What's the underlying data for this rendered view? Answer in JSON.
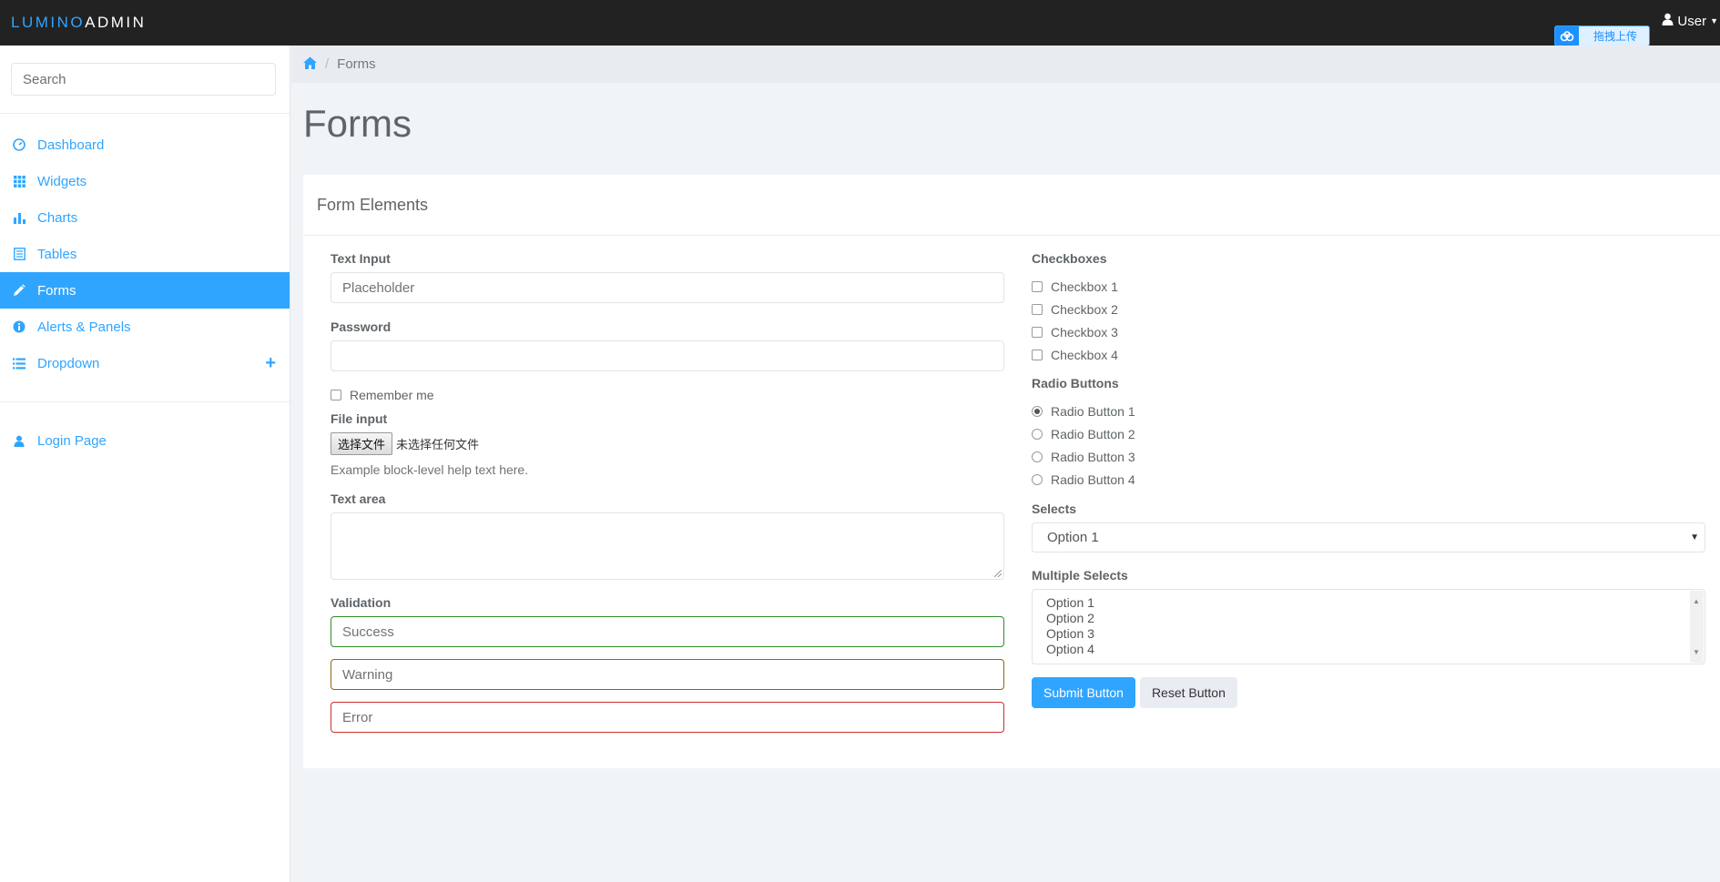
{
  "brand": {
    "part1": "LUMINO",
    "part2": "ADMIN"
  },
  "upload_badge": {
    "label": "拖拽上传"
  },
  "user_menu": {
    "label": "User"
  },
  "sidebar": {
    "search_placeholder": "Search",
    "items": [
      {
        "label": "Dashboard",
        "icon": "dashboard-icon"
      },
      {
        "label": "Widgets",
        "icon": "grid-icon"
      },
      {
        "label": "Charts",
        "icon": "bar-chart-icon"
      },
      {
        "label": "Tables",
        "icon": "table-icon"
      },
      {
        "label": "Forms",
        "icon": "pencil-icon",
        "active": true
      },
      {
        "label": "Alerts & Panels",
        "icon": "info-icon"
      },
      {
        "label": "Dropdown",
        "icon": "list-icon",
        "expand": "+"
      }
    ],
    "login_item": {
      "label": "Login Page",
      "icon": "user-icon"
    }
  },
  "breadcrumb": {
    "current": "Forms"
  },
  "page": {
    "title": "Forms"
  },
  "panel": {
    "heading": "Form Elements",
    "text_input": {
      "label": "Text Input",
      "placeholder": "Placeholder"
    },
    "password": {
      "label": "Password"
    },
    "remember": {
      "label": "Remember me"
    },
    "file_input": {
      "label": "File input",
      "button": "选择文件",
      "status": "未选择任何文件",
      "help": "Example block-level help text here."
    },
    "textarea": {
      "label": "Text area"
    },
    "validation": {
      "label": "Validation",
      "success_placeholder": "Success",
      "warning_placeholder": "Warning",
      "error_placeholder": "Error"
    },
    "checkboxes": {
      "label": "Checkboxes",
      "items": [
        "Checkbox 1",
        "Checkbox 2",
        "Checkbox 3",
        "Checkbox 4"
      ]
    },
    "radios": {
      "label": "Radio Buttons",
      "items": [
        "Radio Button 1",
        "Radio Button 2",
        "Radio Button 3",
        "Radio Button 4"
      ],
      "selected": 0
    },
    "selects": {
      "label": "Selects",
      "value": "Option 1"
    },
    "multiple_selects": {
      "label": "Multiple Selects",
      "options": [
        "Option 1",
        "Option 2",
        "Option 3",
        "Option 4"
      ]
    },
    "buttons": {
      "submit": "Submit Button",
      "reset": "Reset Button"
    }
  },
  "colors": {
    "accent": "#30a5ff",
    "topbar": "#222222",
    "success": "#2e8b2e",
    "warning": "#8b6914",
    "error": "#c9302c"
  }
}
